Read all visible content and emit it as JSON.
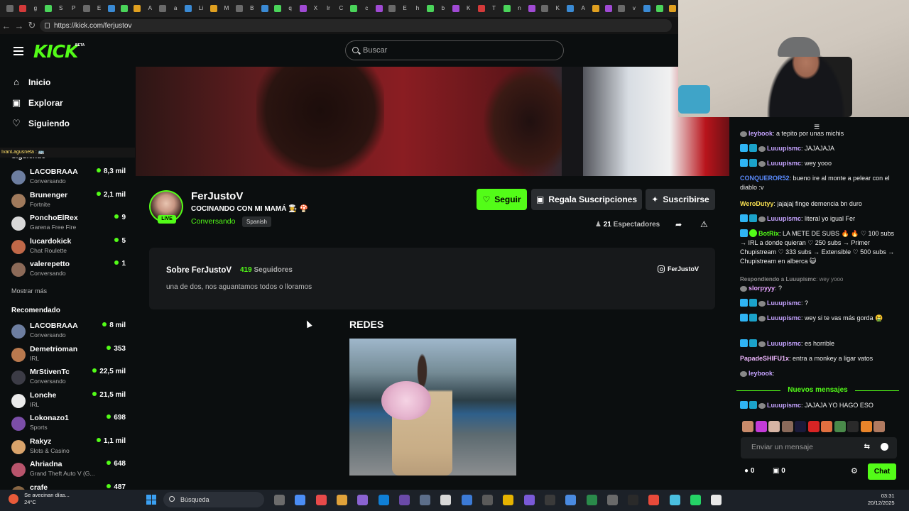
{
  "browser": {
    "url": "https://kick.com/ferjustov",
    "tab_glyphs": [
      "",
      "",
      "g",
      "",
      "S",
      "P",
      "",
      "E",
      "",
      "",
      "",
      "A",
      "",
      "a",
      "",
      "Li",
      "",
      "M",
      "",
      "B",
      "",
      "",
      "q",
      "",
      "X",
      "Ir",
      "C",
      "",
      "c",
      "",
      "",
      "E",
      "h",
      "",
      "b",
      "",
      "K",
      "",
      "T",
      "",
      "n",
      "",
      "",
      "K",
      "",
      "A",
      "",
      "",
      "",
      "v",
      "",
      "",
      ""
    ]
  },
  "header": {
    "logo_text": "KICK",
    "beta_label": "BETA",
    "search_placeholder": "Buscar"
  },
  "sidebar": {
    "nav": [
      {
        "label": "Inicio",
        "icon": "home-icon"
      },
      {
        "label": "Explorar",
        "icon": "compass-icon"
      },
      {
        "label": "Siguiendo",
        "icon": "heart-icon"
      }
    ],
    "overlay_text": "IvanLagusneta : 🚌",
    "following_heading": "Siguiendo",
    "following": [
      {
        "name": "LACOBRAAA",
        "category": "Conversando",
        "viewers": "8,3 mil",
        "color": "#6d7ea0"
      },
      {
        "name": "Brunenger",
        "category": "Fortnite",
        "viewers": "2,1 mil",
        "color": "#a07a5c"
      },
      {
        "name": "PonchoElRex",
        "category": "Garena Free Fire",
        "viewers": "9",
        "color": "#d8d8d8"
      },
      {
        "name": "lucardokick",
        "category": "Chat Roulette",
        "viewers": "5",
        "color": "#c06848"
      },
      {
        "name": "valerepetto",
        "category": "Conversando",
        "viewers": "1",
        "color": "#8c6a58"
      }
    ],
    "show_more": "Mostrar más",
    "recommended_heading": "Recomendado",
    "recommended": [
      {
        "name": "LACOBRAAA",
        "category": "Conversando",
        "viewers": "8 mil",
        "color": "#6d7ea0"
      },
      {
        "name": "Demetrioman",
        "category": "IRL",
        "viewers": "353",
        "color": "#b9794e"
      },
      {
        "name": "MrStivenTc",
        "category": "Conversando",
        "viewers": "22,5 mil",
        "color": "#3c3c46"
      },
      {
        "name": "Lonche",
        "category": "IRL",
        "viewers": "21,5 mil",
        "color": "#ebebeb"
      },
      {
        "name": "Lokonazo1",
        "category": "Sports",
        "viewers": "698",
        "color": "#7b4ea8"
      },
      {
        "name": "Rakyz",
        "category": "Slots & Casino",
        "viewers": "1,1 mil",
        "color": "#d9a36b"
      },
      {
        "name": "Ahriadna",
        "category": "Grand Theft Auto V (G...",
        "viewers": "648",
        "color": "#b8546c"
      },
      {
        "name": "crafe",
        "category": "",
        "viewers": "487",
        "color": "#886644"
      }
    ]
  },
  "channel": {
    "name": "FerJustoV",
    "stream_title": "COCINANDO CON MI MAMÁ 👩‍🍳 🍄",
    "live_label": "LIVE",
    "category": "Conversando",
    "language": "Spanish",
    "follow_label": "Seguir",
    "gift_label": "Regala Suscripciones",
    "subscribe_label": "Suscribirse",
    "viewer_count": "21",
    "viewers_label": "Espectadores"
  },
  "about": {
    "title": "Sobre FerJustoV",
    "followers_count": "419",
    "followers_label": "Seguidores",
    "bio": "una de dos, nos aguantamos todos o lloramos",
    "instagram": "FerJustoV",
    "panel_title": "REDES"
  },
  "chat": {
    "messages": [
      {
        "user": "leybook",
        "text": "a tepito por unas michis",
        "color": "#c5a3ff",
        "badges": [
          "b3"
        ]
      },
      {
        "user": "Luuupismc",
        "text": "JAJAJAJA",
        "color": "#c5a3ff",
        "badges": [
          "b1",
          "b2",
          "b3"
        ]
      },
      {
        "user": "Luuupismc",
        "text": "wey yooo",
        "color": "#c5a3ff",
        "badges": [
          "b1",
          "b2",
          "b3"
        ]
      },
      {
        "user": "CONQUEROR52",
        "text": "bueno ire al monte a pelear con el diablo :v",
        "color": "#5b8cff",
        "badges": []
      },
      {
        "user": "WeroDutyy",
        "text": "jajajaj finge demencia bn duro",
        "color": "#f8e050",
        "badges": []
      },
      {
        "user": "Luuupismc",
        "text": "literal yo igual Fer",
        "color": "#c5a3ff",
        "badges": [
          "b1",
          "b2",
          "b3"
        ]
      },
      {
        "user": "BotRix",
        "text": "LA METE DE SUBS 🔥 🔥 ♡ 100 subs → IRL a donde quieran ♡ 250 subs → Primer Chupistream ♡ 333 subs → Extensible ♡ 500 subs → Chupistream en alberca 😺",
        "color": "#53fc18",
        "badges": [
          "b1",
          "bot"
        ]
      },
      {
        "user": "Respondiendo a Luuupismc",
        "text": "wey yooo",
        "color": "#888888",
        "badges": []
      },
      {
        "user": "slorpyyy",
        "text": "?",
        "color": "#e6a3ff",
        "badges": [
          "b3"
        ]
      },
      {
        "user": "Luuupismc",
        "text": "?",
        "color": "#c5a3ff",
        "badges": [
          "b1",
          "b2",
          "b3"
        ]
      },
      {
        "user": "Luuupismc",
        "text": "wey si te vas más gorda 🤮",
        "color": "#c5a3ff",
        "badges": [
          "b1",
          "b2",
          "b3"
        ]
      },
      {
        "user": "Luuupismc",
        "text": "es horrible",
        "color": "#c5a3ff",
        "badges": [
          "b1",
          "b2",
          "b3"
        ]
      },
      {
        "user": "PapadeSHIFU1x",
        "text": "entra a monkey a ligar vatos",
        "color": "#f0b8ff",
        "badges": []
      },
      {
        "user": "leybook",
        "text": "",
        "color": "#c5a3ff",
        "badges": [
          "b3"
        ]
      },
      {
        "user": "Luuupismc",
        "text": "JAJAJA YO HAGO ESO",
        "color": "#c5a3ff",
        "badges": [
          "b1",
          "b2",
          "b3"
        ]
      }
    ],
    "new_messages_label": "Nuevos mensajes",
    "emote_colors": [
      "#c88a6a",
      "#c33bd8",
      "#d6b4a4",
      "#8a6a5a",
      "#1a1a3a",
      "#d82424",
      "#e07040",
      "#4a8a4a",
      "#2a2a2a",
      "#e8842a",
      "#b07a60"
    ],
    "input_placeholder": "Enviar un mensaje",
    "points_a": "0",
    "points_b": "0",
    "send_label": "Chat"
  },
  "taskbar": {
    "weather_text": "Se avecinan días...",
    "temperature": "24°C",
    "search_label": "Búsqueda",
    "time": "03:31",
    "date": "20/12/2025",
    "icon_colors": [
      "#6c6c6c",
      "#4b8df5",
      "#e84a4a",
      "#e0a23a",
      "#8a63d2",
      "#0f7fd6",
      "#6a4aa8",
      "#5c6e8a",
      "#d8d8d8",
      "#3c7ad6",
      "#5a5a5a",
      "#e6b300",
      "#7a5ad8",
      "#3a3a3a",
      "#4a8ae0",
      "#2a8a4a",
      "#6a6a6a",
      "#2a2a2a",
      "#e84a3a",
      "#4ac0e0",
      "#25d366",
      "#e8e8e8"
    ]
  }
}
